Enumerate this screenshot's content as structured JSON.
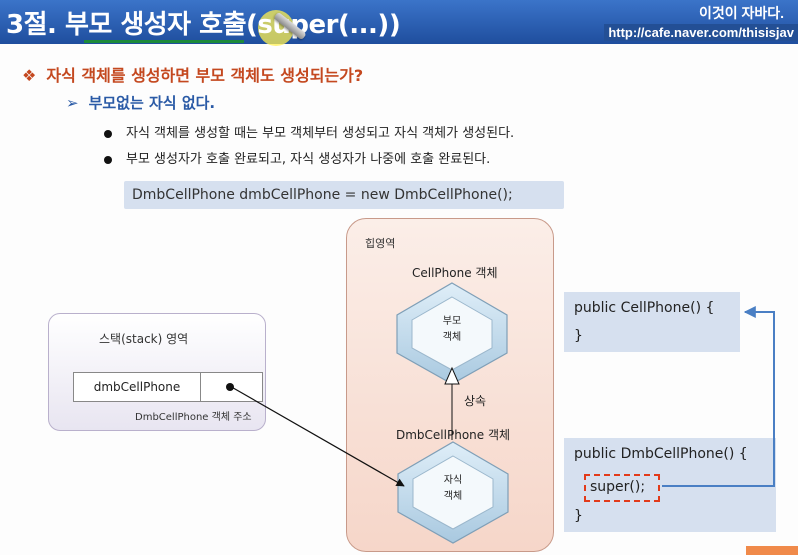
{
  "header": {
    "title": "3절. 부모 생성자 호출(super(...))",
    "brand": "이것이 자바다.",
    "url": "http://cafe.naver.com/thisisjav"
  },
  "content": {
    "question": "자식 객체를 생성하면 부모 객체도 생성되는가?",
    "question_marker": "❖",
    "answer": "부모없는 자식 없다.",
    "answer_marker": "➢",
    "bullets": [
      "자식 객체를 생성할 때는 부모 객체부터 생성되고 자식 객체가 생성된다.",
      "부모 생성자가 호출 완료되고, 자식 생성자가 나중에 호출 완료된다."
    ],
    "code_statement": "DmbCellPhone dmbCellPhone  =  new DmbCellPhone();"
  },
  "diagram": {
    "stack_title": "스택(stack) 영역",
    "variable_name": "dmbCellPhone",
    "address_label": "DmbCellPhone 객체 주소",
    "heap_title": "힙영역",
    "parent_object_label": "CellPhone 객체",
    "parent_hex_text": [
      "부모",
      "객체"
    ],
    "inherit_label": "상속",
    "child_object_label": "DmbCellPhone 객체",
    "child_hex_text": [
      "자식",
      "객체"
    ],
    "parent_constructor": [
      "public CellPhone() {",
      "}"
    ],
    "child_constructor": [
      "public DmbCellPhone() {",
      "super();",
      "}"
    ],
    "colors": {
      "header": "#1f4e9e",
      "question": "#c4481f",
      "answer": "#2a5aa6",
      "code_panel": "#d6e0ef",
      "super_highlight": "#e23a1a",
      "call_arrow": "#4a7fc4"
    }
  }
}
